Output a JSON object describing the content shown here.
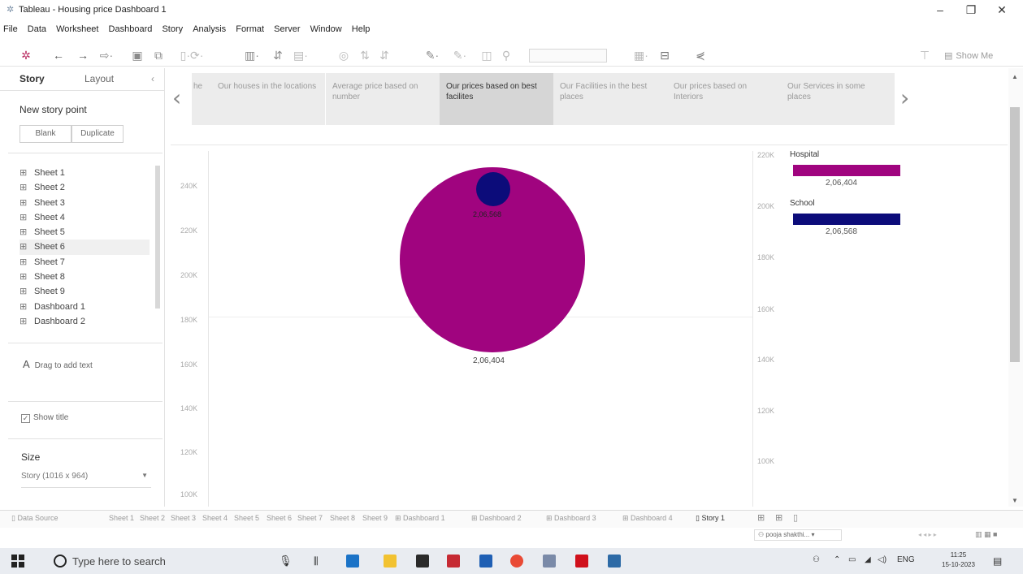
{
  "window": {
    "title": "Tableau - Housing price Dashboard 1"
  },
  "menu": [
    "File",
    "Data",
    "Worksheet",
    "Dashboard",
    "Story",
    "Analysis",
    "Format",
    "Server",
    "Window",
    "Help"
  ],
  "toolbar": {
    "show_me": "Show Me"
  },
  "left_pane": {
    "tabs": {
      "story": "Story",
      "layout": "Layout"
    },
    "new_story_point": "New story point",
    "blank": "Blank",
    "duplicate": "Duplicate",
    "sheets": [
      {
        "label": "Sheet 1",
        "type": "sheet"
      },
      {
        "label": "Sheet 2",
        "type": "sheet"
      },
      {
        "label": "Sheet 3",
        "type": "sheet"
      },
      {
        "label": "Sheet 4",
        "type": "sheet"
      },
      {
        "label": "Sheet 5",
        "type": "sheet"
      },
      {
        "label": "Sheet 6",
        "type": "sheet"
      },
      {
        "label": "Sheet 7",
        "type": "sheet"
      },
      {
        "label": "Sheet 8",
        "type": "sheet"
      },
      {
        "label": "Sheet 9",
        "type": "sheet"
      },
      {
        "label": "Dashboard 1",
        "type": "dashboard"
      },
      {
        "label": "Dashboard 2",
        "type": "dashboard"
      }
    ],
    "drag_text": "Drag to add text",
    "show_title": "Show title",
    "size_header": "Size",
    "size_value": "Story (1016 x 964)"
  },
  "story_points": [
    {
      "label": "Our houses in the locations",
      "active": false
    },
    {
      "label": "Average price based on number",
      "active": false
    },
    {
      "label": "Our prices based on best facilites",
      "active": true
    },
    {
      "label": "Our Facilities in the best places",
      "active": false
    },
    {
      "label": "Our prices based on Interiors",
      "active": false
    },
    {
      "label": "Our Services in some places",
      "active": false
    }
  ],
  "story_prev_partial": "he",
  "colors": {
    "hospital": "#a0047f",
    "school": "#0c0c7a",
    "accent": "#1f6fb2"
  },
  "chart_data": [
    {
      "type": "scatter",
      "y_ticks": [
        "240K",
        "220K",
        "200K",
        "180K",
        "160K",
        "140K",
        "120K",
        "100K"
      ],
      "series": [
        {
          "name": "Hospital",
          "value": 206404,
          "label": "2,06,404",
          "color": "#a0047f"
        },
        {
          "name": "School",
          "value": 206568,
          "label": "2,06,568",
          "color": "#0c0c7a"
        }
      ]
    },
    {
      "type": "bar",
      "y_ticks": [
        "220K",
        "200K",
        "180K",
        "160K",
        "140K",
        "120K",
        "100K"
      ],
      "categories": [
        "Hospital",
        "School"
      ],
      "values": [
        206404,
        206568
      ],
      "labels": [
        "2,06,404",
        "2,06,568"
      ]
    }
  ],
  "sheet_tabs": [
    {
      "label": "Data Source",
      "active": false
    },
    {
      "label": "Sheet 1",
      "active": false
    },
    {
      "label": "Sheet 2",
      "active": false
    },
    {
      "label": "Sheet 3",
      "active": false
    },
    {
      "label": "Sheet 4",
      "active": false
    },
    {
      "label": "Sheet 5",
      "active": false
    },
    {
      "label": "Sheet 6",
      "active": false
    },
    {
      "label": "Sheet 7",
      "active": false
    },
    {
      "label": "Sheet 8",
      "active": false
    },
    {
      "label": "Sheet 9",
      "active": false
    },
    {
      "label": "Dashboard 1",
      "active": false
    },
    {
      "label": "Dashboard 2",
      "active": false
    },
    {
      "label": "Dashboard 3",
      "active": false
    },
    {
      "label": "Dashboard 4",
      "active": false
    },
    {
      "label": "Story 1",
      "active": true
    }
  ],
  "status": {
    "user": "pooja shakthi..."
  },
  "taskbar": {
    "search_placeholder": "Type here to search",
    "lang": "ENG",
    "time": "11:25",
    "date": "15-10-2023"
  }
}
